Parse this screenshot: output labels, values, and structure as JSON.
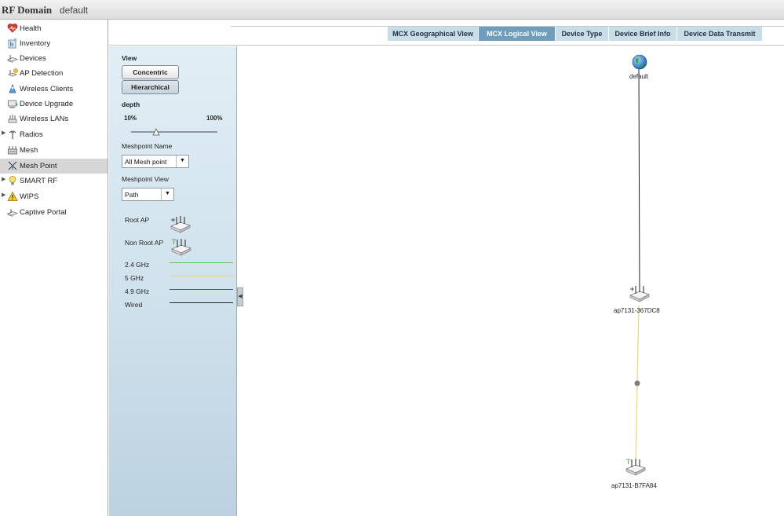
{
  "title_bar": {
    "title": "RF Domain",
    "domain": "default"
  },
  "nav": {
    "items": [
      {
        "label": "Health",
        "icon": "health-icon"
      },
      {
        "label": "Inventory",
        "icon": "inventory-icon"
      },
      {
        "label": "Devices",
        "icon": "devices-icon"
      },
      {
        "label": "AP Detection",
        "icon": "ap-detection-icon"
      },
      {
        "label": "Wireless Clients",
        "icon": "wireless-clients-icon"
      },
      {
        "label": "Device Upgrade",
        "icon": "device-upgrade-icon"
      },
      {
        "label": "Wireless LANs",
        "icon": "wireless-lans-icon"
      },
      {
        "label": "Radios",
        "icon": "radios-icon",
        "expandable": true
      },
      {
        "label": "Mesh",
        "icon": "mesh-icon"
      },
      {
        "label": "Mesh Point",
        "icon": "mesh-point-icon",
        "selected": true
      },
      {
        "label": "SMART RF",
        "icon": "smart-rf-icon",
        "expandable": true
      },
      {
        "label": "WIPS",
        "icon": "wips-icon",
        "expandable": true
      },
      {
        "label": "Captive Portal",
        "icon": "captive-portal-icon"
      }
    ]
  },
  "tabs": [
    {
      "label": "MCX Geographical View"
    },
    {
      "label": "MCX Logical View",
      "active": true
    },
    {
      "label": "Device Type"
    },
    {
      "label": "Device Brief Info"
    },
    {
      "label": "Device Data Transmit"
    }
  ],
  "panel": {
    "view_label": "View",
    "concentric_label": "Concentric",
    "hierarchical_label": "Hierarchical",
    "depth_label": "depth",
    "depth_min": "10%",
    "depth_max": "100%",
    "depth_value_fraction": 0.3,
    "meshpoint_name_label": "Meshpoint Name",
    "meshpoint_name_value": "All Mesh point",
    "meshpoint_view_label": "Meshpoint View",
    "meshpoint_view_value": "Path",
    "legend": {
      "root_ap": "Root AP",
      "non_root_ap": "Non Root AP",
      "bands": [
        {
          "label": "2.4 GHz",
          "color": "#5cc25c"
        },
        {
          "label": "5 GHz",
          "color": "#e7d67a"
        },
        {
          "label": "4.9 GHz",
          "color": "#3b44c4"
        },
        {
          "label": "Wired",
          "color": "#222222"
        }
      ]
    }
  },
  "topology": {
    "root": {
      "label": "default",
      "icon": "globe-icon"
    },
    "root_ap": {
      "label": "ap7131-367DC8"
    },
    "non_root_ap": {
      "label": "ap7131-B7FA84"
    },
    "links": [
      {
        "from": "default",
        "to": "ap7131-367DC8",
        "type": "Wired"
      },
      {
        "from": "ap7131-367DC8",
        "to": "ap7131-B7FA84",
        "type": "5 GHz"
      }
    ]
  }
}
